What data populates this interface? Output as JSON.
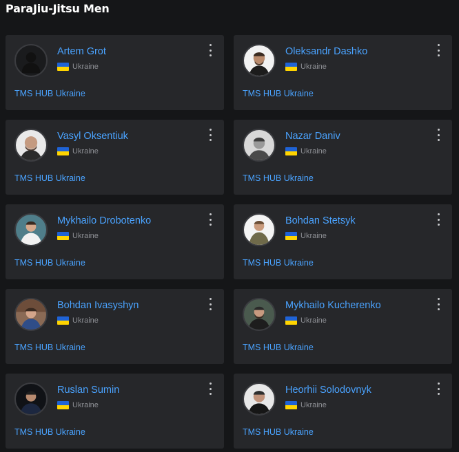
{
  "page": {
    "title": "ParaJiu-Jitsu Men"
  },
  "colors": {
    "link": "#4aa3ff",
    "card": "#26272a",
    "background": "#151618"
  },
  "athletes": [
    {
      "name": "Artem Grot",
      "country": "Ukraine",
      "team": "TMS HUB Ukraine",
      "avatar": "placeholder-silhouette",
      "flag": "ukraine-flag-icon"
    },
    {
      "name": "Oleksandr Dashko",
      "country": "Ukraine",
      "team": "TMS HUB Ukraine",
      "avatar": "photo",
      "flag": "ukraine-flag-icon"
    },
    {
      "name": "Vasyl Oksentiuk",
      "country": "Ukraine",
      "team": "TMS HUB Ukraine",
      "avatar": "photo",
      "flag": "ukraine-flag-icon"
    },
    {
      "name": "Nazar Daniv",
      "country": "Ukraine",
      "team": "TMS HUB Ukraine",
      "avatar": "photo",
      "flag": "ukraine-flag-icon"
    },
    {
      "name": "Mykhailo Drobotenko",
      "country": "Ukraine",
      "team": "TMS HUB Ukraine",
      "avatar": "photo",
      "flag": "ukraine-flag-icon"
    },
    {
      "name": "Bohdan Stetsyk",
      "country": "Ukraine",
      "team": "TMS HUB Ukraine",
      "avatar": "photo",
      "flag": "ukraine-flag-icon"
    },
    {
      "name": "Bohdan Ivasyshyn",
      "country": "Ukraine",
      "team": "TMS HUB Ukraine",
      "avatar": "photo",
      "flag": "ukraine-flag-icon"
    },
    {
      "name": "Mykhailo Kucherenko",
      "country": "Ukraine",
      "team": "TMS HUB Ukraine",
      "avatar": "photo",
      "flag": "ukraine-flag-icon"
    },
    {
      "name": "Ruslan Sumin",
      "country": "Ukraine",
      "team": "TMS HUB Ukraine",
      "avatar": "photo",
      "flag": "ukraine-flag-icon"
    },
    {
      "name": "Heorhii Solodovnyk",
      "country": "Ukraine",
      "team": "TMS HUB Ukraine",
      "avatar": "photo",
      "flag": "ukraine-flag-icon"
    }
  ]
}
